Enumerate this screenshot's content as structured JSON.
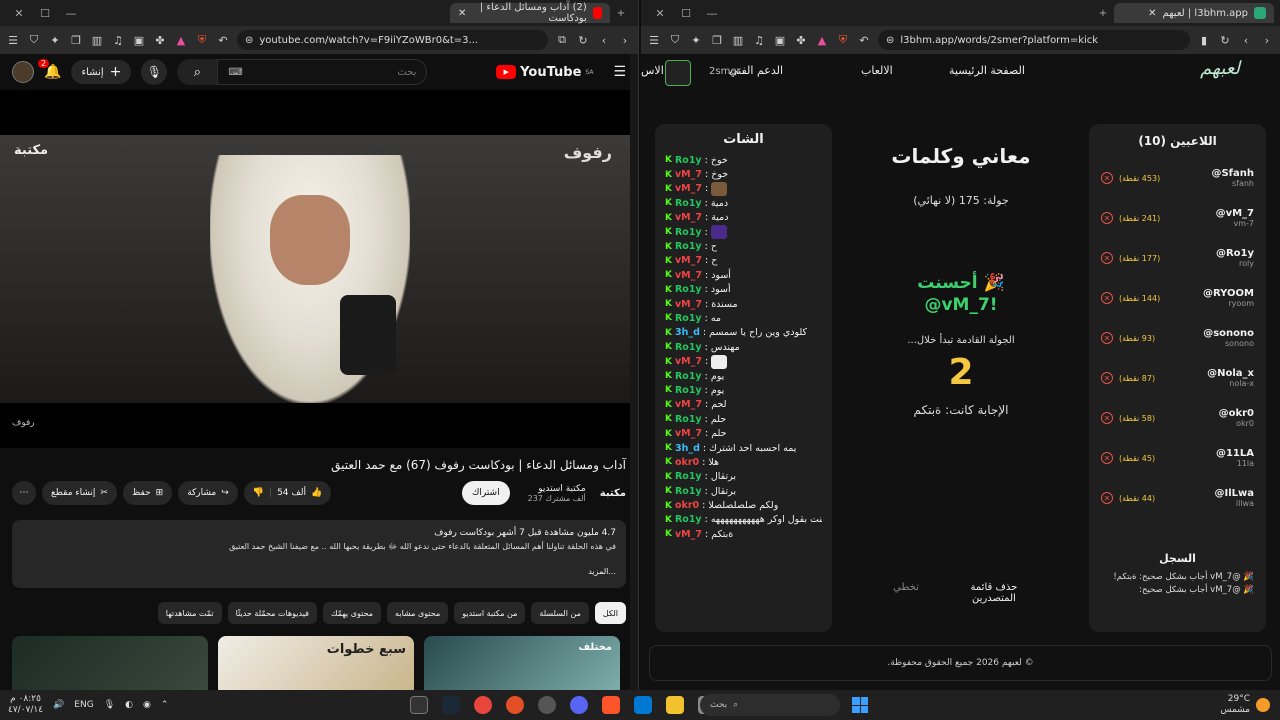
{
  "left_window": {
    "tab_title": "(2) آداب ومسائل الدعاء | بودكاست",
    "url": "youtube.com/watch?v=F9iiYZoWBr0&t=3...",
    "youtube": {
      "logo": "YouTube",
      "logo_region": "SA",
      "search_placeholder": "بحث",
      "create_label": "إنشاء",
      "notif_count": "2",
      "video_watermark_left": "مكتبة",
      "video_watermark_right": "رفوف",
      "video_corner": "رفوف",
      "video_title": "آداب ومسائل الدعاء | بودكاست رفوف (67) مع حمد العتيق",
      "like_count": "54 ألف",
      "share_label": "مشاركة",
      "save_label": "حفظ",
      "clip_label": "إنشاء مقطع",
      "subscribe_label": "اشتراك",
      "channel_name": "مكتبة استديو",
      "channel_subs": "237 ألف مشترك",
      "channel_logo": "مكتبة",
      "desc_meta": "4.7 مليون مشاهدة قبل 7 أشهر  بودكاست رفوف",
      "desc_text": "في هذه الحلقة تناولنا أهم المسائل المتعلقة بالدعاء حتى ندعو الله ﷻ بطريقة يحبها الله .. مع ضيفنا الشيخ حمد العتيق",
      "desc_more": "...المزيد",
      "chips": [
        "الكل",
        "من السلسلة",
        "من مكتبة استديو",
        "محتوى مشابه",
        "محتوى يهمّك",
        "فيديوهات محمّلة حديثًا",
        "تمّت مشاهدتها"
      ],
      "thumb_titles": [
        "",
        "سبع خطوات",
        "مختلف"
      ]
    }
  },
  "right_window": {
    "tab_title": "l3bhm.app | لعبهم",
    "url": "l3bhm.app/words/2smer?platform=kick",
    "site": {
      "logo": "لعبهم",
      "nav": [
        "الصفحة الرئيسية",
        "الالعاب",
        "الدعم الفني"
      ],
      "nav_cut": "الاس",
      "username": "2smer",
      "chat_title": "الشات",
      "chat": [
        {
          "user": "Ro1y",
          "color": "#22c55e",
          "text": "خوخ"
        },
        {
          "user": "vM_7",
          "color": "#ef4444",
          "text": "خوخ"
        },
        {
          "user": "vM_7",
          "color": "#ef4444",
          "text": "",
          "emote": "#7a5a3a"
        },
        {
          "user": "Ro1y",
          "color": "#22c55e",
          "text": "دمية"
        },
        {
          "user": "vM_7",
          "color": "#ef4444",
          "text": "دمية"
        },
        {
          "user": "Ro1y",
          "color": "#22c55e",
          "text": "",
          "emote": "#4b2b8a"
        },
        {
          "user": "Ro1y",
          "color": "#22c55e",
          "text": "ح"
        },
        {
          "user": "vM_7",
          "color": "#ef4444",
          "text": "ح"
        },
        {
          "user": "vM_7",
          "color": "#ef4444",
          "text": "أسود"
        },
        {
          "user": "Ro1y",
          "color": "#22c55e",
          "text": "أسود"
        },
        {
          "user": "vM_7",
          "color": "#ef4444",
          "text": "مسندة"
        },
        {
          "user": "Ro1y",
          "color": "#22c55e",
          "text": "مه"
        },
        {
          "user": "3h_d",
          "color": "#38bdf8",
          "text": "كلودي وين راح يا سمسم"
        },
        {
          "user": "Ro1y",
          "color": "#22c55e",
          "text": "مهندس"
        },
        {
          "user": "vM_7",
          "color": "#ef4444",
          "text": "",
          "emote": "#eeeeee"
        },
        {
          "user": "Ro1y",
          "color": "#22c55e",
          "text": "يوم"
        },
        {
          "user": "Ro1y",
          "color": "#22c55e",
          "text": "يوم"
        },
        {
          "user": "vM_7",
          "color": "#ef4444",
          "text": "لحم"
        },
        {
          "user": "Ro1y",
          "color": "#22c55e",
          "text": "حلم"
        },
        {
          "user": "vM_7",
          "color": "#ef4444",
          "text": "حلم"
        },
        {
          "user": "3h_d",
          "color": "#38bdf8",
          "text": "يمه احسبه احد اشترك"
        },
        {
          "user": "okr0",
          "color": "#ef4444",
          "text": "هلا"
        },
        {
          "user": "Ro1y",
          "color": "#22c55e",
          "text": "برتقال"
        },
        {
          "user": "Ro1y",
          "color": "#22c55e",
          "text": "برتقال"
        },
        {
          "user": "okr0",
          "color": "#ef4444",
          "text": "ولكم صلصلصلصلا"
        },
        {
          "user": "Ro1y",
          "color": "#22c55e",
          "text": "كنت بقول اوكر هههههههههههه"
        },
        {
          "user": "vM_7",
          "color": "#ef4444",
          "text": "ةبتكم"
        }
      ],
      "game_title": "معاني وكلمات",
      "round_text": "جولة: 175 (لا نهائي)",
      "bravo": "🎉 أحسنت",
      "winner": "@vM_7!",
      "next_round": "الجولة القادمة تبدأ خلال...",
      "countdown": "2",
      "answer": "الإجابة كانت: ةبتكم",
      "clear_btn": "حذف قائمة المتصدرين",
      "skip_btn": "تخطي",
      "players_title": "اللاعبين (10)",
      "players": [
        {
          "name": "@Sfanh",
          "handle": "sfanh",
          "score": "(453 نقطة)"
        },
        {
          "name": "@vM_7",
          "handle": "vm-7",
          "score": "(241 نقطة)"
        },
        {
          "name": "@Ro1y",
          "handle": "roly",
          "score": "(177 نقطة)"
        },
        {
          "name": "@RYOOM",
          "handle": "ryoom",
          "score": "(144 نقطة)"
        },
        {
          "name": "@sonono",
          "handle": "sonono",
          "score": "(93 نقطة)"
        },
        {
          "name": "@Nola_x",
          "handle": "nola-x",
          "score": "(87 نقطة)"
        },
        {
          "name": "@okr0",
          "handle": "okr0",
          "score": "(58 نقطة)"
        },
        {
          "name": "@11LA",
          "handle": "11la",
          "score": "(45 نقطة)"
        },
        {
          "name": "@IlLwa",
          "handle": "illwa",
          "score": "(44 نقطة)"
        }
      ],
      "log_title": "السجل",
      "log": [
        "🎉 @vM_7 أجاب بشكل صحيح: ةبتكم!",
        "🎉 @vM_7 أجاب بشكل صحيح:"
      ],
      "footer": "© لعبهم 2026 جميع الحقوق محفوظة."
    }
  },
  "taskbar": {
    "time": "٠٨:٢٥ م",
    "date": "٤٧/٠٧/١٤",
    "lang": "ENG",
    "search_placeholder": "بحث",
    "temp": "29°C",
    "weather": "مشمس"
  }
}
